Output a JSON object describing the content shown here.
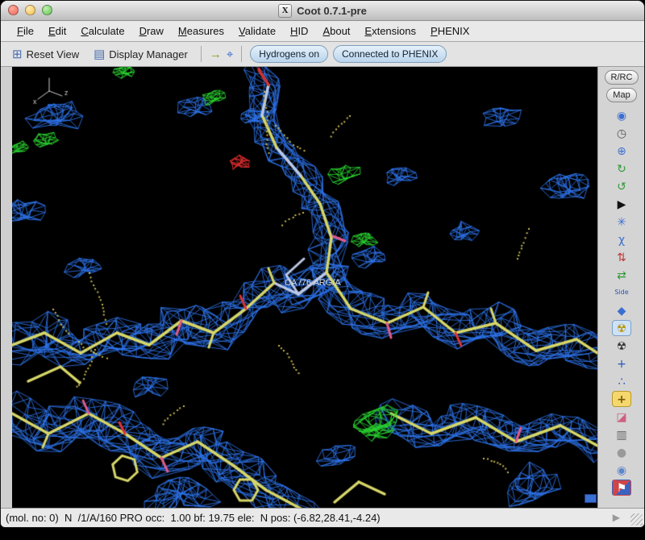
{
  "window": {
    "title": "Coot 0.7.1-pre",
    "icon_glyph": "X"
  },
  "menu": {
    "items": [
      {
        "label": "File",
        "name": "menu-file"
      },
      {
        "label": "Edit",
        "name": "menu-edit"
      },
      {
        "label": "Calculate",
        "name": "menu-calculate"
      },
      {
        "label": "Draw",
        "name": "menu-draw"
      },
      {
        "label": "Measures",
        "name": "menu-measures"
      },
      {
        "label": "Validate",
        "name": "menu-validate"
      },
      {
        "label": "HID",
        "name": "menu-hid"
      },
      {
        "label": "About",
        "name": "menu-about"
      },
      {
        "label": "Extensions",
        "name": "menu-extensions"
      },
      {
        "label": "PHENIX",
        "name": "menu-phenix"
      }
    ]
  },
  "toolbar": {
    "reset_icon": "⊞",
    "reset_label": "Reset View",
    "display_manager_icon": "▤",
    "display_manager_label": "Display Manager",
    "goto_atom_icon": "→",
    "goto_ligand_icon": "⌖",
    "hydrogens_label": "Hydrogens on",
    "phenix_label": "Connected to PHENIX"
  },
  "side_buttons": {
    "rrc": "R/RC",
    "map": "Map"
  },
  "right_toolbar": {
    "icons": [
      {
        "name": "view-orient-icon",
        "glyph": "◉",
        "color": "#3b6fd1"
      },
      {
        "name": "clock-timer-icon",
        "glyph": "◷",
        "color": "#555555"
      },
      {
        "name": "centre-atom-icon",
        "glyph": "⊕",
        "color": "#3b6fd1"
      },
      {
        "name": "rotate-zone-icon",
        "glyph": "↻",
        "color": "#2f9a35"
      },
      {
        "name": "torsion-general-icon",
        "glyph": "↺",
        "color": "#2f9a35"
      },
      {
        "name": "run-script-icon",
        "glyph": "▶",
        "color": "#111111"
      },
      {
        "name": "rotamer-icon",
        "glyph": "✳",
        "color": "#3b6fd1"
      },
      {
        "name": "chi-angle-icon",
        "glyph": "χ",
        "color": "#3b6fd1"
      },
      {
        "name": "flip-peptide-icon",
        "glyph": "⇅",
        "color": "#c03535"
      },
      {
        "name": "rot-trans-zone-icon",
        "glyph": "⇄",
        "color": "#2f9a35"
      },
      {
        "name": "side-chain-180-icon",
        "glyph": "Side",
        "color": "#2255bb",
        "cls": "tiny"
      },
      {
        "name": "mutate-residue-icon",
        "glyph": "◆",
        "color": "#3b6fd1"
      },
      {
        "name": "real-space-refine-icon",
        "glyph": "☢",
        "color": "#b8960a",
        "cls": "active"
      },
      {
        "name": "regularize-zone-icon",
        "glyph": "☢",
        "color": "#333333"
      },
      {
        "name": "add-atom-icon",
        "glyph": "+",
        "color": "#2255bb"
      },
      {
        "name": "triple-refine-icon",
        "glyph": "∴",
        "color": "#2255bb"
      },
      {
        "name": "add-terminal-residue-icon",
        "glyph": "+",
        "color": "#7a5a00",
        "cls": "boxed"
      },
      {
        "name": "eraser-icon",
        "glyph": "◪",
        "color": "#d06080"
      },
      {
        "name": "delete-item-icon",
        "glyph": "▥",
        "color": "#666666"
      },
      {
        "name": "undo-icon",
        "glyph": "●",
        "color": "#999999"
      },
      {
        "name": "sphere-refine-icon",
        "glyph": "◉",
        "color": "#5b86cc"
      },
      {
        "name": "screenshot-icon",
        "glyph": "⚑",
        "color": "#ffffff",
        "cls": "flagbox"
      }
    ]
  },
  "canvas": {
    "residue_label": "CA /76 ARG/A",
    "axis_labels": [
      "x",
      "z"
    ]
  },
  "status_bar": {
    "text": "(mol. no: 0)  N  /1/A/160 PRO occ:  1.00 bf: 19.75 ele:  N pos: (-6.82,28.41,-4.24)",
    "play_glyph": "▶"
  }
}
